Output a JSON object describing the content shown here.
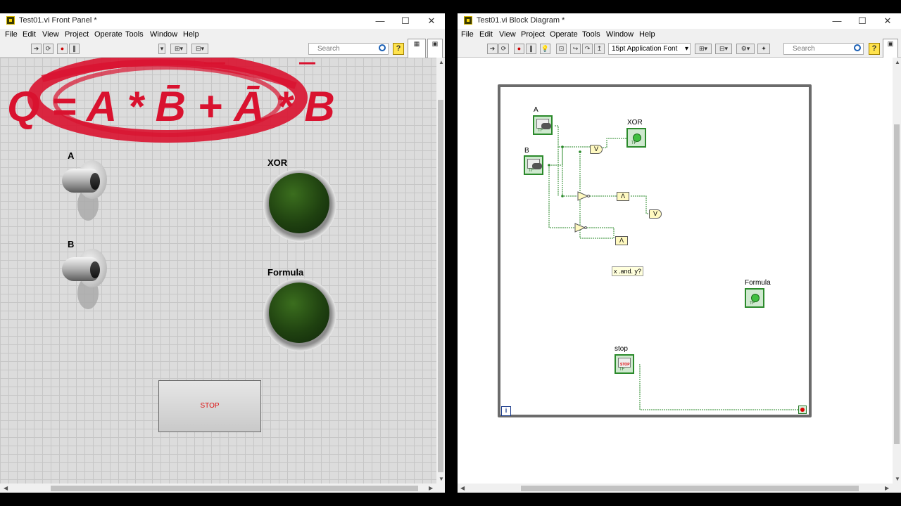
{
  "front_panel": {
    "title": "Test01.vi Front Panel *",
    "window_controls": [
      "—",
      "☐",
      "✕"
    ],
    "menu": [
      "File",
      "Edit",
      "View",
      "Project",
      "Operate",
      "Tools",
      "Window",
      "Help"
    ],
    "search_placeholder": "Search",
    "help_label": "?",
    "formula_text": "Q = A * B̄ + Ā * B",
    "controls": {
      "a_label": "A",
      "b_label": "B",
      "xor_label": "XOR",
      "formula_label": "Formula",
      "stop_label": "STOP"
    },
    "colors": {
      "accent_red": "#d9122f",
      "led_green": "#2a5a16"
    }
  },
  "block_diagram": {
    "title": "Test01.vi Block Diagram *",
    "window_controls": [
      "—",
      "☐",
      "✕"
    ],
    "menu": [
      "File",
      "Edit",
      "View",
      "Project",
      "Operate",
      "Tools",
      "Window",
      "Help"
    ],
    "font_select": "15pt Application Font",
    "search_placeholder": "Search",
    "help_label": "?",
    "terminals": {
      "a": "A",
      "b": "B",
      "xor": "XOR",
      "formula": "Formula",
      "stop": "stop"
    },
    "and_label": "x .and. y?",
    "iteration_label": "i",
    "primitives": {
      "or": "V",
      "and": "Λ"
    }
  }
}
